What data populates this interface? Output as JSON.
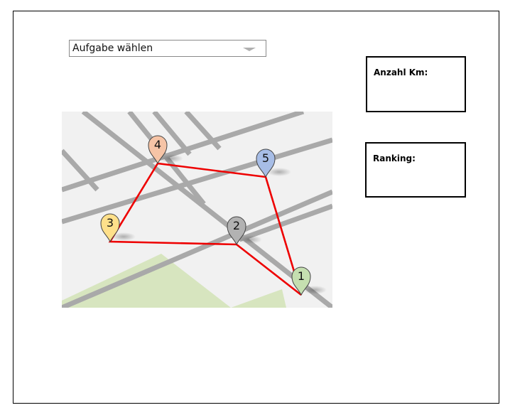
{
  "task_select": {
    "selected": "Aufgabe wählen"
  },
  "km_box": {
    "label": "Anzahl Km:"
  },
  "ranking_box": {
    "label": "Ranking:"
  },
  "map": {
    "markers": [
      {
        "label": "1",
        "color": "#c5dfb0"
      },
      {
        "label": "2",
        "color": "#b2b2b2"
      },
      {
        "label": "3",
        "color": "#ffe08a"
      },
      {
        "label": "4",
        "color": "#f6c4a6"
      },
      {
        "label": "5",
        "color": "#a7bde6"
      }
    ],
    "route_order": [
      "1",
      "2",
      "3",
      "4",
      "5",
      "1"
    ],
    "route_color": "#ee0000",
    "park_color": "#d7e5bf",
    "road_color": "#a9a9a9",
    "background_color": "#f1f1f1"
  }
}
